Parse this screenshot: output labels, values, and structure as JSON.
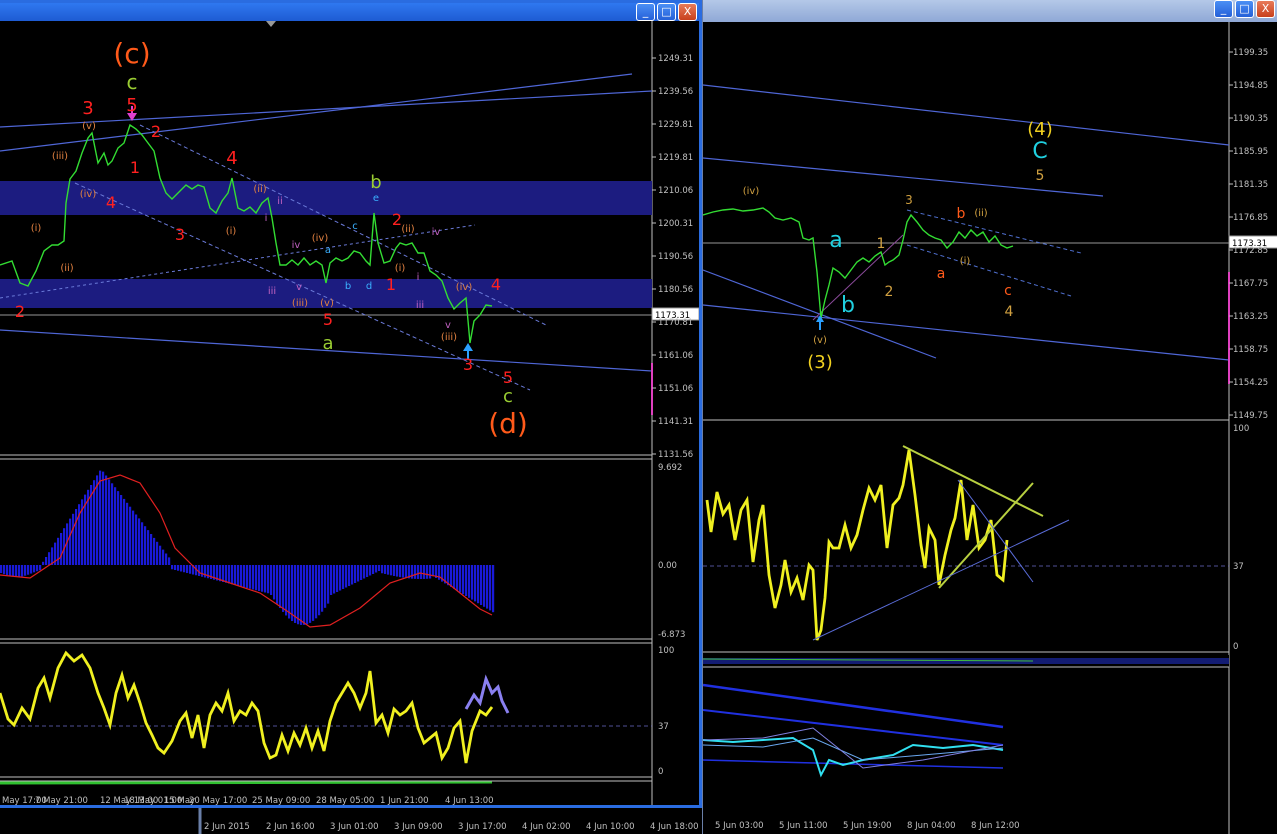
{
  "left": {
    "price_ticks": [
      "1249.31",
      "1239.56",
      "1229.81",
      "1219.81",
      "1210.06",
      "1200.31",
      "1190.56",
      "1180.56",
      "1170.81",
      "1161.06",
      "1151.06",
      "1141.31",
      "1131.56"
    ],
    "current_price": "1173.31",
    "date_ticks": [
      "05:00",
      "7 May 21:00",
      "12 May 13:00",
      "15 May",
      "18 May 01:00",
      "20 May 17:00",
      "25 May 09:00",
      "28 May 05:00",
      "1 Jun 21:00",
      "4 Jun 13:00",
      "May 17:00"
    ],
    "bottom_dates": [
      "2 Jun 2015",
      "2 Jun 16:00",
      "3 Jun 01:00",
      "3 Jun 09:00",
      "3 Jun 17:00",
      "4 Jun 02:00",
      "4 Jun 10:00",
      "4 Jun 18:00"
    ],
    "macd_ticks": [
      "9.692",
      "0.00",
      "-6.873"
    ],
    "rsi_ticks": [
      "100",
      "37",
      "0"
    ],
    "labels": {
      "c_big": "(c)",
      "c_small": "c",
      "five_top": "5",
      "three_top": "3",
      "one": "1",
      "two": "2",
      "v_top": "(v)",
      "iii_top": "(iii)",
      "iv_top": "(iv)",
      "i_top": "(i)",
      "ii_top": "(ii)",
      "four_a": "4",
      "four_b": "4",
      "three_b": "3",
      "two_left": "2",
      "i2": "(i)",
      "ii2": "(ii)",
      "i_lc": "i",
      "ii_lc": "ii",
      "iii_lc": "iii",
      "iv_lc": "iv",
      "v_lc": "v",
      "iv2": "(iv)",
      "iii2": "(iii)",
      "v2": "(v)",
      "five_mid": "5",
      "a_green": "a",
      "a_blue": "a",
      "b_blue": "b",
      "c_blue": "c",
      "d_blue": "d",
      "e_blue": "e",
      "b_green": "b",
      "two_r": "2",
      "ii_r": "(ii)",
      "iv_r": "iv",
      "one_r": "1",
      "i_r": "(i)",
      "i_r2": "i",
      "iii_r": "iii",
      "v_r": "v",
      "iii_r2": "(iii)",
      "iv_r2": "(iv)",
      "four_r": "4",
      "three_r": "3",
      "five_r": "5",
      "c_r": "c",
      "d_big": "(d)"
    }
  },
  "right": {
    "price_ticks": [
      "1199.35",
      "1194.85",
      "1190.35",
      "1185.95",
      "1181.35",
      "1176.85",
      "1172.85",
      "1167.75",
      "1163.25",
      "1158.75",
      "1154.25",
      "1149.75"
    ],
    "current_price": "1173.31",
    "date_ticks": [
      "5 Jun 03:00",
      "5 Jun 11:00",
      "5 Jun 19:00",
      "8 Jun 04:00",
      "8 Jun 12:00"
    ],
    "rsi_ticks": [
      "100",
      "37",
      "0"
    ],
    "labels": {
      "four_big": "(4)",
      "c_cyan": "C",
      "five": "5",
      "iv": "(iv)",
      "a_cyan": "a",
      "b_cyan": "b",
      "v": "(v)",
      "three_big": "(3)",
      "one": "1",
      "two": "2",
      "three": "3",
      "b_red": "b",
      "ii": "(ii)",
      "a_red": "a",
      "i": "(i)",
      "c_red": "c",
      "four": "4"
    }
  },
  "titlebar_buttons": [
    "_",
    "□",
    "X"
  ]
}
